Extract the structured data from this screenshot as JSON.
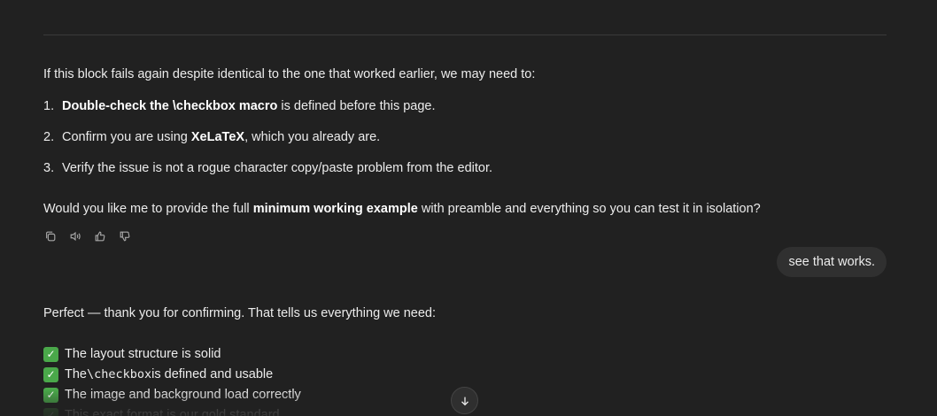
{
  "assistant_message_1": {
    "intro": "If this block fails again despite identical to the one that worked earlier, we may need to:",
    "steps": [
      {
        "num": "1.",
        "bold": "Double-check the \\checkbox macro",
        "rest": " is defined before this page."
      },
      {
        "num": "2.",
        "pre": "Confirm you are using ",
        "bold": "XeLaTeX",
        "rest": ", which you already are."
      },
      {
        "num": "3.",
        "pre": "Verify the issue is not a rogue character copy/paste problem from the editor."
      }
    ],
    "question_pre": "Would you like me to provide the full ",
    "question_bold": "minimum working example",
    "question_post": " with preamble and everything so you can test it in isolation?"
  },
  "message_actions": [
    "copy-icon",
    "read-aloud-icon",
    "thumbs-up-icon",
    "thumbs-down-icon"
  ],
  "user_message": "see that works.",
  "assistant_message_2": {
    "intro": "Perfect — thank you for confirming. That tells us everything we need:",
    "checks": [
      {
        "pre": "The layout structure is solid"
      },
      {
        "pre": "The ",
        "code": "\\checkbox",
        "post": " is defined and usable"
      },
      {
        "pre": "The image and background load correctly"
      },
      {
        "pre": "This exact format is our gold standard"
      }
    ]
  },
  "colors": {
    "background": "#212121",
    "text": "#ececec",
    "user_bubble": "#303030",
    "check_green": "#4aa84a"
  }
}
